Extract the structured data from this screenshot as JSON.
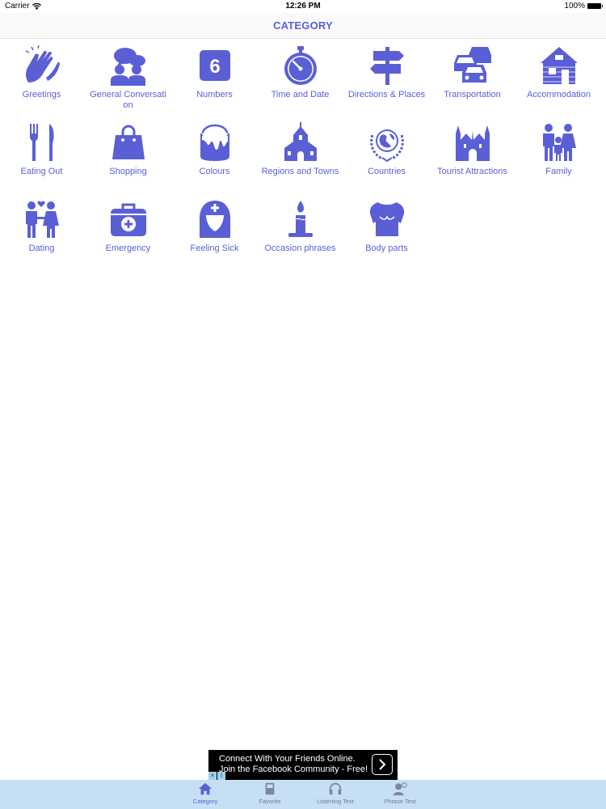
{
  "status_bar": {
    "carrier": "Carrier",
    "time": "12:26 PM",
    "battery": "100%"
  },
  "nav": {
    "title": "CATEGORY"
  },
  "accent_color": "#5a5fd6",
  "categories": [
    {
      "label": "Greetings",
      "icon": "clapping-hands-icon"
    },
    {
      "label": "General Conversation",
      "icon": "conversation-icon"
    },
    {
      "label": "Numbers",
      "icon": "number-six-icon"
    },
    {
      "label": "Time and Date",
      "icon": "stopwatch-icon"
    },
    {
      "label": "Directions & Places",
      "icon": "signpost-icon"
    },
    {
      "label": "Transportation",
      "icon": "cars-icon"
    },
    {
      "label": "Accommodation",
      "icon": "log-cabin-icon"
    },
    {
      "label": "Eating Out",
      "icon": "fork-knife-icon"
    },
    {
      "label": "Shopping",
      "icon": "shopping-bag-icon"
    },
    {
      "label": "Colours",
      "icon": "paint-bucket-icon"
    },
    {
      "label": "Regions and Towns",
      "icon": "church-icon"
    },
    {
      "label": "Countries",
      "icon": "globe-emblem-icon"
    },
    {
      "label": "Tourist Attractions",
      "icon": "castle-icon"
    },
    {
      "label": "Family",
      "icon": "family-icon"
    },
    {
      "label": "Dating",
      "icon": "couple-icon"
    },
    {
      "label": "Emergency",
      "icon": "first-aid-kit-icon"
    },
    {
      "label": "Feeling Sick",
      "icon": "nurse-icon"
    },
    {
      "label": "Occasion phrases",
      "icon": "candle-icon"
    },
    {
      "label": "Body parts",
      "icon": "torso-icon"
    }
  ],
  "ad": {
    "line1": "Connect With Your Friends Online.",
    "line2": "Join the Facebook Community - Free!"
  },
  "tabs": [
    {
      "label": "Category",
      "icon": "home-icon",
      "active": true
    },
    {
      "label": "Favorite",
      "icon": "book-icon",
      "active": false
    },
    {
      "label": "Listening Test",
      "icon": "headphones-icon",
      "active": false
    },
    {
      "label": "Phrase Test",
      "icon": "person-speech-icon",
      "active": false
    }
  ]
}
